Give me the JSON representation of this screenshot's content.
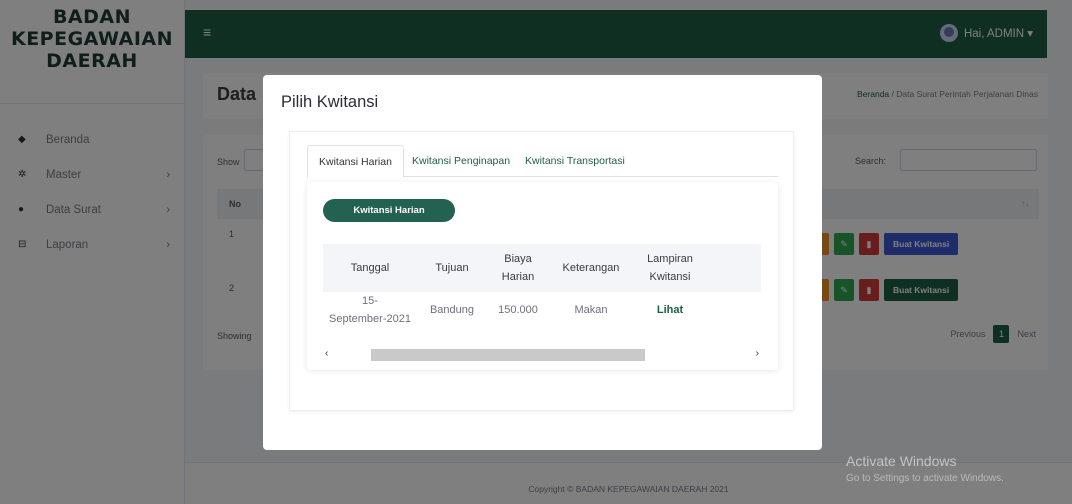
{
  "brand": {
    "line1": "BADAN",
    "line2": "KEPEGAWAIAN",
    "line3": "DAERAH"
  },
  "sidebar": {
    "items": [
      {
        "label": "Beranda",
        "icon": "dashboard-icon",
        "glyph": "◆",
        "has_submenu": false
      },
      {
        "label": "Master",
        "icon": "gear-icon",
        "glyph": "✲",
        "has_submenu": true
      },
      {
        "label": "Data Surat",
        "icon": "circle-icon",
        "glyph": "●",
        "has_submenu": true
      },
      {
        "label": "Laporan",
        "icon": "print-icon",
        "glyph": "⊟",
        "has_submenu": true
      }
    ],
    "chevron": "›"
  },
  "topbar": {
    "menu_glyph": "≡",
    "user_label": "Hai, ADMIN ▾"
  },
  "page": {
    "title": "Data",
    "breadcrumb_home": "Beranda",
    "breadcrumb_sep": " / ",
    "breadcrumb_current": "Data Surat Perintah Perjalanan Dinas"
  },
  "table_bg": {
    "show_label": "Show",
    "search_label": "Search:",
    "col_no": "No",
    "sort_glyph": "↑↓",
    "rows": [
      {
        "no": "1",
        "buat_label": "Buat Kwitansi"
      },
      {
        "no": "2",
        "buat_label": "Buat Kwitansi"
      }
    ],
    "edit_glyph": "✎",
    "delete_glyph": "▮",
    "showing_label": "Showing",
    "pager": {
      "previous": "Previous",
      "current": "1",
      "next": "Next"
    }
  },
  "footer": {
    "copyright": "Copyright © BADAN KEPEGAWAIAN DAERAH 2021"
  },
  "watermark": {
    "line1": "Activate Windows",
    "line2": "Go to Settings to activate Windows."
  },
  "modal": {
    "title": "Pilih Kwitansi",
    "tabs": [
      {
        "label": "Kwitansi Harian",
        "active": true
      },
      {
        "label": "Kwitansi Penginapan",
        "active": false
      },
      {
        "label": "Kwitansi Transportasi",
        "active": false
      }
    ],
    "section_button": "Kwitansi Harian",
    "columns": [
      "Tanggal",
      "Tujuan",
      "Biaya\nHarian",
      "Keterangan",
      "Lampiran\nKwitansi"
    ],
    "rows": [
      {
        "tanggal": "15-\nSeptember-2021",
        "tujuan": "Bandung",
        "biaya": "150.000",
        "keterangan": "Makan",
        "lampiran": "Lihat"
      }
    ],
    "scroll_left": "‹",
    "scroll_right": "›"
  },
  "colors": {
    "brand_green": "#1f5e47",
    "blue_button": "#3c5bd4",
    "danger": "#d33b3b",
    "success": "#2fa84f"
  }
}
